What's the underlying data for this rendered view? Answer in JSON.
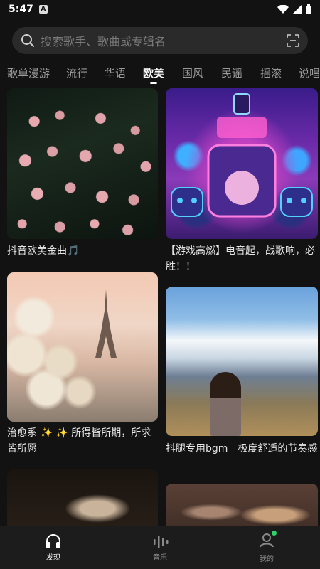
{
  "status_bar": {
    "time": "5:47",
    "notification_badge": "A",
    "icons": [
      "wifi-icon",
      "signal-icon",
      "battery-icon"
    ]
  },
  "search": {
    "placeholder": "搜索歌手、歌曲或专辑名",
    "icon": "search-icon",
    "scan_icon": "scan-icon"
  },
  "tabs": [
    {
      "label": "歌单漫游",
      "active": false
    },
    {
      "label": "流行",
      "active": false
    },
    {
      "label": "华语",
      "active": false
    },
    {
      "label": "欧美",
      "active": true
    },
    {
      "label": "国风",
      "active": false
    },
    {
      "label": "民谣",
      "active": false
    },
    {
      "label": "摇滚",
      "active": false
    },
    {
      "label": "说唱",
      "active": false
    }
  ],
  "cards": [
    {
      "title": "抖音欧美金曲🎵",
      "image": "pink tulips with bubbles"
    },
    {
      "title": "【游戏高燃】电音起，战歌响，必胜！！",
      "image": "neon robot stage"
    },
    {
      "title": "治愈系 ✨ ✨ 所得皆所期，所求皆所愿",
      "image": "white roses and eiffel tower"
    },
    {
      "title": "抖腿专用bgm｜极度舒适的节奏感",
      "image": "snowy mountain with woman"
    },
    {
      "title": "",
      "image": "singer on stage"
    },
    {
      "title": "",
      "image": "people portrait"
    }
  ],
  "bottom_nav": [
    {
      "label": "发现",
      "icon": "headphones-icon",
      "active": true
    },
    {
      "label": "音乐",
      "icon": "music-bars-icon",
      "active": false
    },
    {
      "label": "我的",
      "icon": "profile-icon",
      "active": false,
      "badge_color": "#2fd16a"
    }
  ]
}
